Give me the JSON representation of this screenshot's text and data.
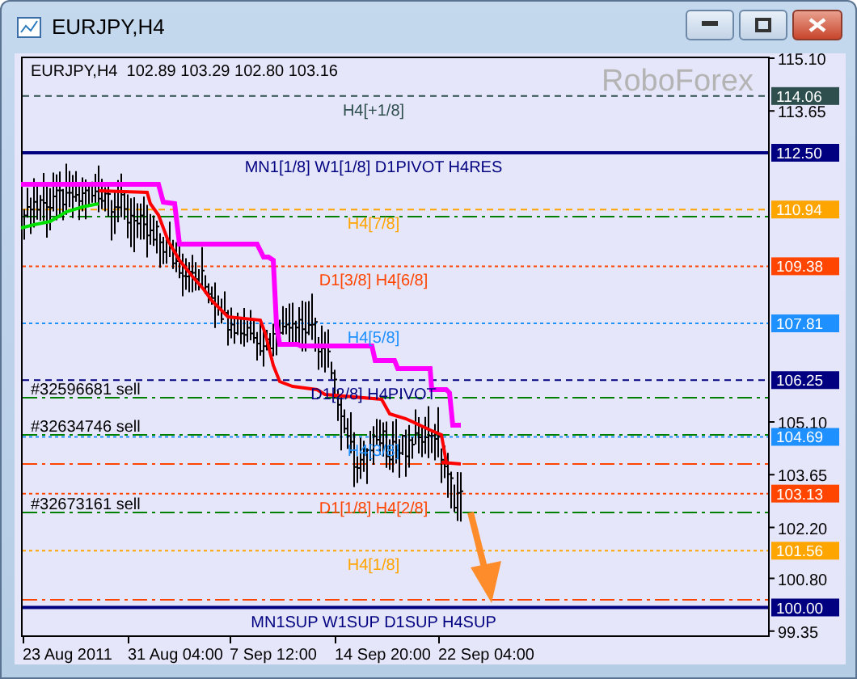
{
  "window": {
    "title": "EURJPY,H4"
  },
  "chart": {
    "info": "EURJPY,H4  102.89 103.29 102.80 103.16",
    "logo_text": "RoboForex",
    "levels": [
      {
        "label": "H4[+1/8]",
        "price": "114.06",
        "color": "#2f4f4f"
      },
      {
        "label": "MN1[1/8] W1[1/8] D1PIVOT H4RES",
        "price": "112.50",
        "color": "#000080"
      },
      {
        "label": "H4[7/8]",
        "price": "110.94",
        "color": "#ffa500"
      },
      {
        "label": "D1[3/8] H4[6/8]",
        "price": "109.38",
        "color": "#ff4500"
      },
      {
        "label": "H4[5/8]",
        "price": "107.81",
        "color": "#1e90ff"
      },
      {
        "label": "D1[2/8] H4PIVOT",
        "price": "106.25",
        "color": "#000080"
      },
      {
        "label": "H4[3/8]",
        "price": "104.69",
        "color": "#1e90ff"
      },
      {
        "label": "D1[1/8] H4[2/8]",
        "price": "103.13",
        "color": "#ff4500"
      },
      {
        "label": "H4[1/8]",
        "price": "101.56",
        "color": "#ffa500"
      },
      {
        "label": "MN1SUP W1SUP D1SUP H4SUP",
        "price": "100.00",
        "color": "#000080"
      }
    ],
    "orders": [
      {
        "label": "#32596681 sell"
      },
      {
        "label": "#32634746 sell"
      },
      {
        "label": "#32673161 sell"
      }
    ],
    "price_ticks": [
      "115.10",
      "113.65",
      "105.10",
      "103.65",
      "102.20",
      "100.80",
      "99.35"
    ],
    "time_labels": [
      "23 Aug 2011",
      "31 Aug 04:00",
      "7 Sep 12:00",
      "14 Sep 20:00",
      "22 Sep 04:00"
    ]
  }
}
